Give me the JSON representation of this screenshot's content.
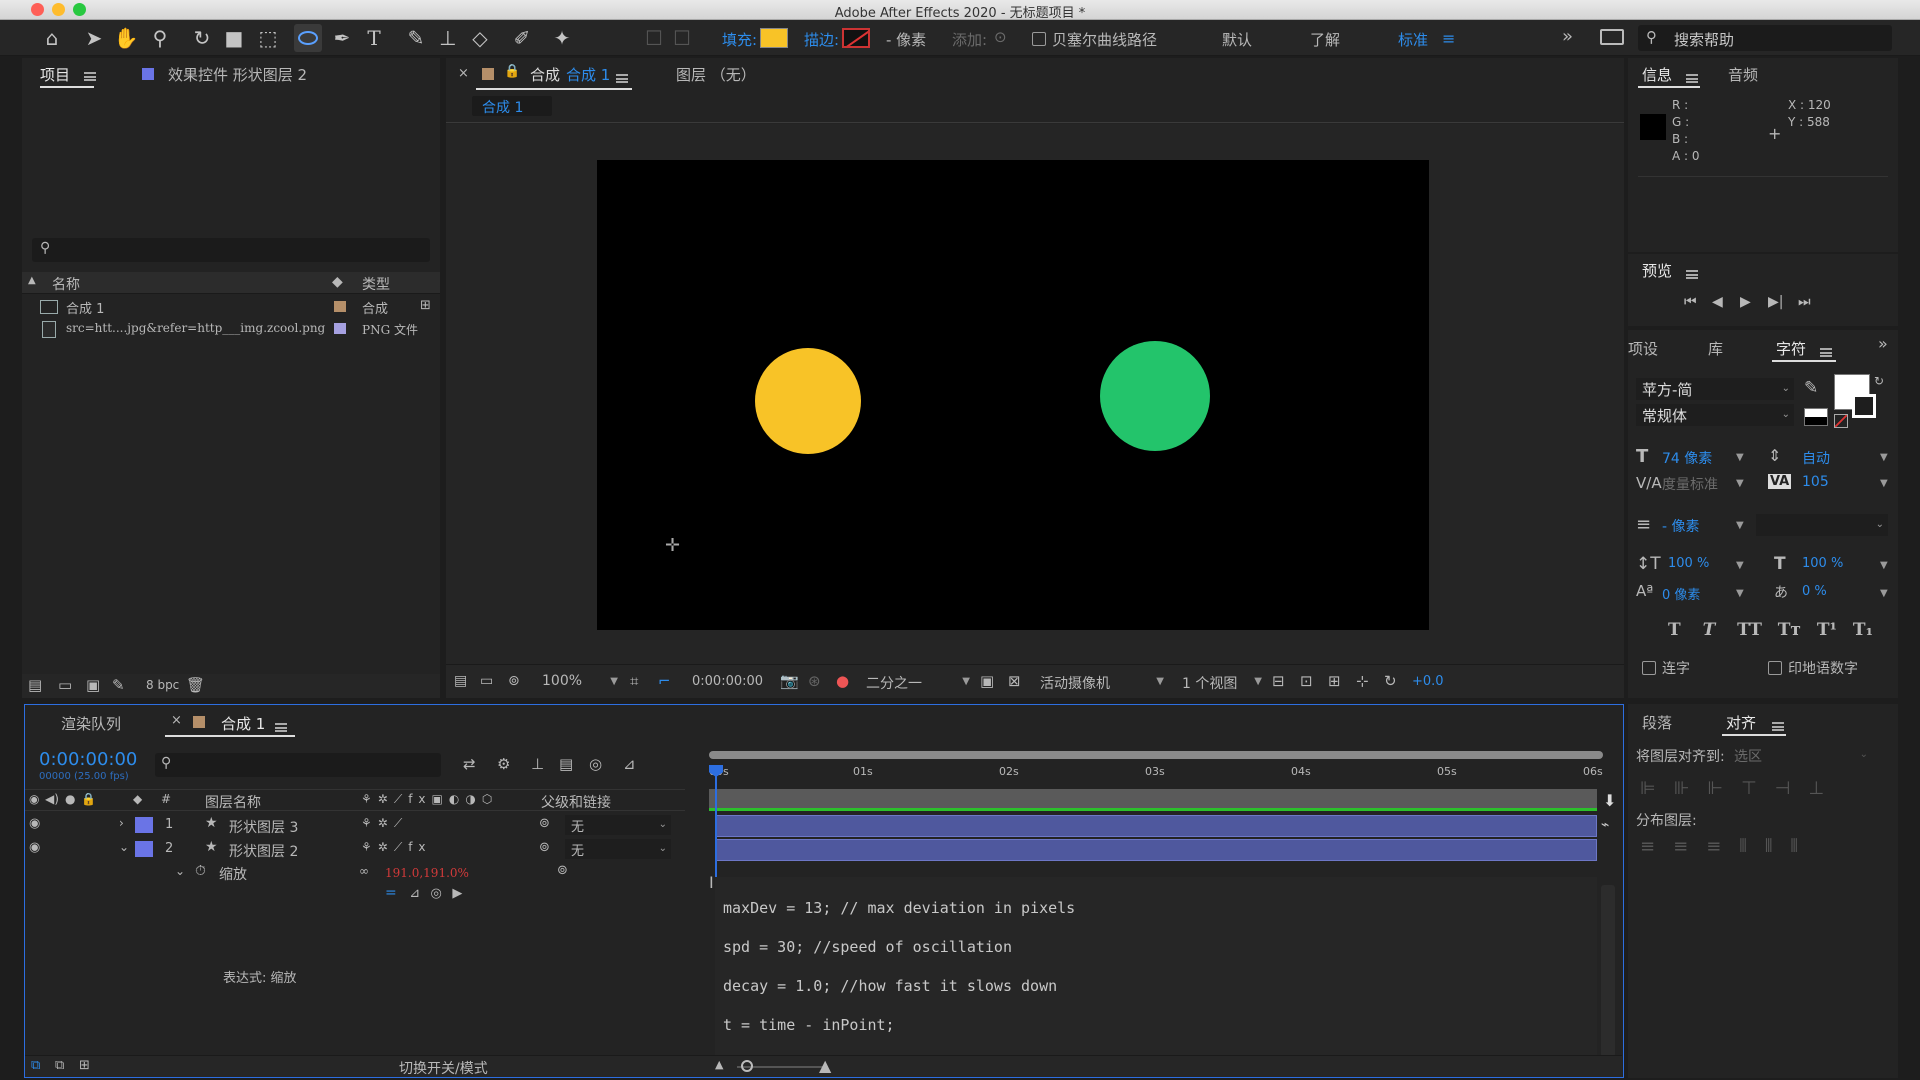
{
  "window": {
    "title": "Adobe After Effects 2020 - 无标题项目 *",
    "traffic_lights": [
      "#fe5f57",
      "#febc2e",
      "#28c840"
    ]
  },
  "toolbar": {
    "fill_label": "填充:",
    "fill_color": "#f8c327",
    "stroke_label": "描边:",
    "stroke_px": "- 像素",
    "add_label": "添加:",
    "bezier_label": "贝塞尔曲线路径",
    "workspace_default": "默认",
    "workspace_learn": "了解",
    "workspace_standard": "标准",
    "search_placeholder": "搜索帮助"
  },
  "project_panel": {
    "tab_project": "项目",
    "tab_effects": "效果控件 形状图层 2",
    "col_name": "名称",
    "col_type": "类型",
    "items": [
      {
        "name": "合成 1",
        "type": "合成",
        "color": "#b58f69"
      },
      {
        "name": "src=htt....jpg&refer=http___img.zcool.png",
        "type": "PNG 文件",
        "color": "#a5a0e0"
      }
    ],
    "bpc": "8 bpc"
  },
  "comp_panel": {
    "tab_comp_prefix": "合成",
    "tab_comp_name": "合成 1",
    "tab_layer": "图层 （无）",
    "breadcrumb": "合成 1",
    "zoom": "100%",
    "timecode": "0:00:00:00",
    "resolution": "二分之一",
    "camera": "活动摄像机",
    "views": "1 个视图",
    "exposure": "+0.0",
    "circle_yellow": "#f8c327",
    "circle_green": "#23c46b"
  },
  "info_panel": {
    "tab_info": "信息",
    "tab_audio": "音频",
    "r": "R :",
    "g": "G :",
    "b": "B :",
    "a": "A : 0",
    "x": "X : 120",
    "y": "Y : 588"
  },
  "preview_panel": {
    "title": "预览"
  },
  "character_panel": {
    "tab_presets": "项设",
    "tab_library": "库",
    "tab_character": "字符",
    "font": "苹方-简",
    "style": "常规体",
    "size": "74 像素",
    "leading": "自动",
    "kerning": "度量标准",
    "tracking": "105",
    "stroke_width": "- 像素",
    "vscale": "100 %",
    "hscale": "100 %",
    "baseline": "0 像素",
    "tsume": "0 %",
    "ligatures": "连字",
    "hindi_digits": "印地语数字"
  },
  "timeline": {
    "tab_render": "渲染队列",
    "tab_comp": "合成 1",
    "timecode": "0:00:00:00",
    "fps": "00000 (25.00 fps)",
    "col_layer_name": "图层名称",
    "col_parent": "父级和链接",
    "ruler": [
      "00s",
      "01s",
      "02s",
      "03s",
      "04s",
      "05s",
      "06s"
    ],
    "layers": [
      {
        "index": "1",
        "name": "形状图层 3",
        "parent": "无",
        "color": "#6a74e6"
      },
      {
        "index": "2",
        "name": "形状图层 2",
        "parent": "无",
        "color": "#6a74e6"
      }
    ],
    "prop_scale": "缩放",
    "scale_value": "191.0,191.0%",
    "expression_label": "表达式: 缩放",
    "expression_lines": [
      "maxDev = 13; // max deviation in pixels",
      "spd = 30; //speed of oscillation",
      "decay = 1.0; //how fast it slows down",
      "t = time - inPoint;"
    ],
    "toggle_modes": "切换开关/模式"
  },
  "paragraph_panel": {
    "tab_paragraph": "段落",
    "tab_align": "对齐",
    "align_to_label": "将图层对齐到:",
    "align_to_value": "选区",
    "distribute_label": "分布图层:"
  }
}
